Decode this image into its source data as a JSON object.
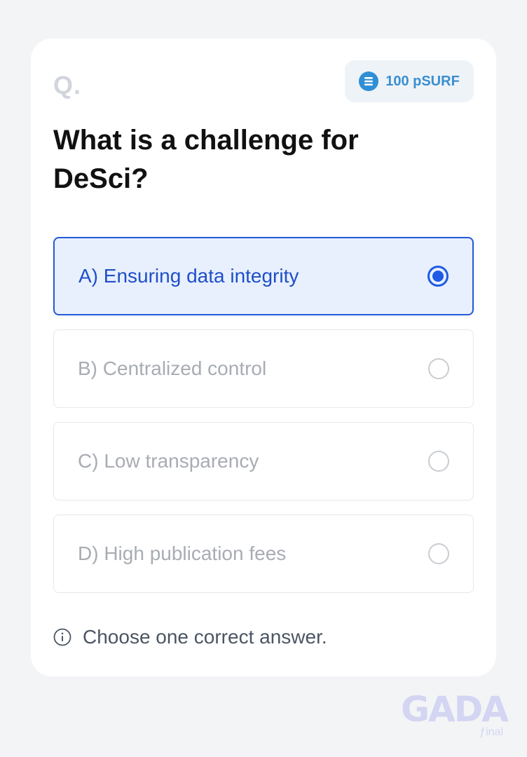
{
  "question_label": "Q.",
  "reward": {
    "icon": "coin-icon",
    "text": "100 pSURF",
    "color": "#3a8fd0"
  },
  "question": "What is a challenge for DeSci?",
  "options": [
    {
      "label": "A) Ensuring data integrity",
      "selected": true
    },
    {
      "label": "B) Centralized control",
      "selected": false
    },
    {
      "label": "C) Low transparency",
      "selected": false
    },
    {
      "label": "D) High publication fees",
      "selected": false
    }
  ],
  "hint": {
    "icon": "info-icon",
    "text": "Choose one correct answer."
  },
  "watermark": {
    "text": "GADA",
    "sub": "ƒinal"
  },
  "colors": {
    "accent": "#1e5ae6",
    "selected_bg": "#e8f0fd",
    "page_bg": "#f3f4f6"
  }
}
